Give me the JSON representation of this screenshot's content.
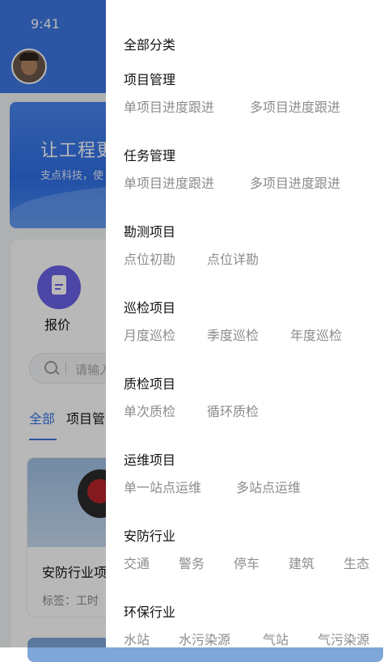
{
  "status_bar": {
    "time": "9:41"
  },
  "background": {
    "banner": {
      "title": "让工程更",
      "subtitle": "支点科技，使"
    },
    "quick_action": {
      "label": "报价"
    },
    "search": {
      "placeholder": "请输入"
    },
    "tabs": [
      {
        "label": "全部"
      },
      {
        "label": "项目管"
      }
    ],
    "project_card": {
      "title": "安防行业项",
      "tags": "标签：工时"
    }
  },
  "drawer": {
    "title": "全部分类",
    "sections": [
      {
        "title": "项目管理",
        "items": [
          "单项目进度跟进",
          "多项目进度跟进"
        ]
      },
      {
        "title": "任务管理",
        "items": [
          "单项目进度跟进",
          "多项目进度跟进"
        ]
      },
      {
        "title": "勘测项目",
        "items": [
          "点位初勘",
          "点位详勘"
        ]
      },
      {
        "title": "巡检项目",
        "items": [
          "月度巡检",
          "季度巡检",
          "年度巡检"
        ]
      },
      {
        "title": "质检项目",
        "items": [
          "单次质检",
          "循环质检"
        ]
      },
      {
        "title": "运维项目",
        "items": [
          "单一站点运维",
          "多站点运维"
        ]
      },
      {
        "title": "安防行业",
        "items": [
          "交通",
          "警务",
          "停车",
          "建筑",
          "生态"
        ]
      },
      {
        "title": "环保行业",
        "items": [
          "水站",
          "水污染源",
          "气站",
          "气污染源"
        ]
      }
    ]
  },
  "colors": {
    "accent": "#3e78e4",
    "quote_icon": "#6a62e8"
  }
}
